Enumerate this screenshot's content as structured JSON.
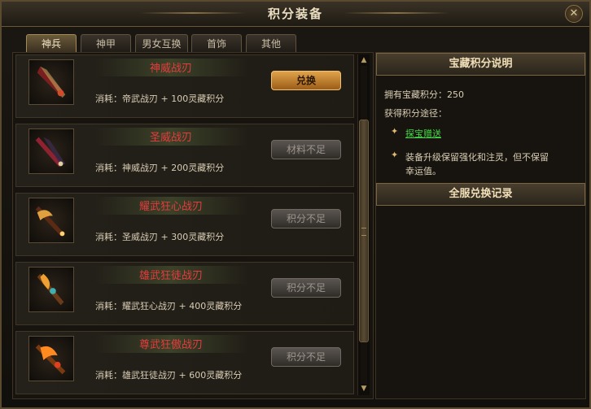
{
  "window": {
    "title": "积分装备",
    "close_glyph": "✕"
  },
  "tabs": [
    {
      "label": "神兵",
      "active": true
    },
    {
      "label": "神甲",
      "active": false
    },
    {
      "label": "男女互换",
      "active": false
    },
    {
      "label": "首饰",
      "active": false
    },
    {
      "label": "其他",
      "active": false
    }
  ],
  "items": [
    {
      "name": "神威战刃",
      "cost": "消耗：帝武战刃 + 100灵藏积分",
      "button": "兑换",
      "enabled": true,
      "icon": "sword-icon"
    },
    {
      "name": "圣威战刃",
      "cost": "消耗：神威战刃 + 200灵藏积分",
      "button": "材料不足",
      "enabled": false,
      "icon": "sword-icon"
    },
    {
      "name": "耀武狂心战刃",
      "cost": "消耗：圣威战刃 + 300灵藏积分",
      "button": "积分不足",
      "enabled": false,
      "icon": "sword-icon"
    },
    {
      "name": "雄武狂徒战刃",
      "cost": "消耗：耀武狂心战刃 + 400灵藏积分",
      "button": "积分不足",
      "enabled": false,
      "icon": "sword-icon"
    },
    {
      "name": "尊武狂傲战刃",
      "cost": "消耗：雄武狂徒战刃 + 600灵藏积分",
      "button": "积分不足",
      "enabled": false,
      "icon": "sword-icon"
    }
  ],
  "scrollbar": {
    "up_glyph": "▲",
    "down_glyph": "▼"
  },
  "info": {
    "header": "宝藏积分说明",
    "points_line": "拥有宝藏积分：250",
    "ways_label": "获得积分途径：",
    "bullet_glyph": "✦",
    "way1": "探宝赠送",
    "way2_line1": "装备升级保留强化和注灵，但不保留",
    "way2_line2": "幸运值。"
  },
  "records": {
    "header": "全服兑换记录"
  },
  "colors": {
    "item_name": "#e53c3c",
    "link": "#46d846",
    "accent": "#a48a55"
  }
}
